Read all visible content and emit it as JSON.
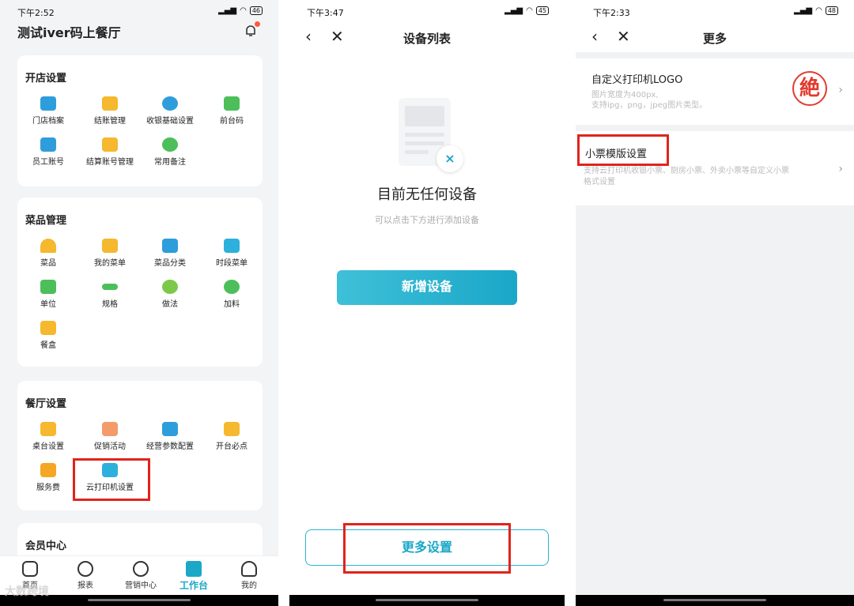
{
  "colors": {
    "accent": "#1aa7c8",
    "highlight": "#e0241b",
    "badge": "#ff5a3c"
  },
  "phone1": {
    "time": "下午2:52",
    "battery": "46",
    "title": "测试iver码上餐厅",
    "sections": [
      {
        "title": "开店设置",
        "items": [
          "门店档案",
          "结账管理",
          "收银基础设置",
          "前台码",
          "员工账号",
          "结算账号管理",
          "常用备注"
        ]
      },
      {
        "title": "菜品管理",
        "items": [
          "菜品",
          "我的菜单",
          "菜品分类",
          "时段菜单",
          "单位",
          "规格",
          "做法",
          "加料",
          "餐盒"
        ]
      },
      {
        "title": "餐厅设置",
        "items": [
          "桌台设置",
          "促销活动",
          "经营参数配置",
          "开台必点",
          "服务费",
          "云打印机设置"
        ]
      },
      {
        "title": "会员中心",
        "items": []
      }
    ],
    "tabs": [
      "首页",
      "报表",
      "营销中心",
      "工作台",
      "我的"
    ]
  },
  "phone2": {
    "time": "下午3:47",
    "battery": "45",
    "title": "设备列表",
    "empty_title": "目前无任何设备",
    "empty_hint": "可以点击下方进行添加设备",
    "add_button": "新增设备",
    "more_button": "更多设置"
  },
  "phone3": {
    "time": "下午2:33",
    "battery": "48",
    "title": "更多",
    "logo_row": {
      "title": "自定义打印机LOGO",
      "desc1": "图片宽度为400px,",
      "desc2": "支持ipg，png，jpeg图片类型。",
      "logo_char": "絶"
    },
    "receipt_row": {
      "title": "小票模版设置",
      "desc1": "支持云打印机收银小票、厨房小票、外卖小票等自定义小票",
      "desc2": "格式设置"
    }
  },
  "watermark": "大数跨境"
}
